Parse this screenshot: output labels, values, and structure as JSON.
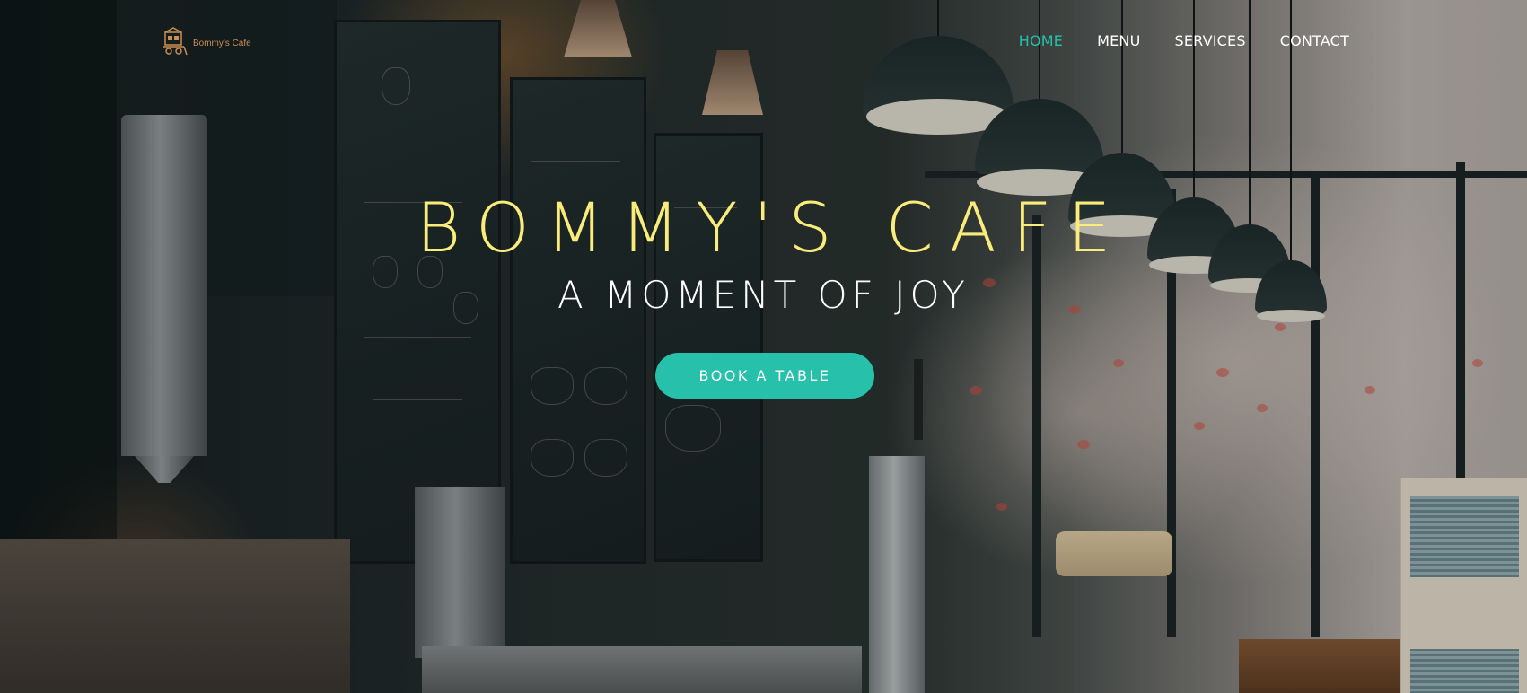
{
  "brand": {
    "logo_text": "Bommy's Cafe",
    "logo_icon": "coffee-cart-icon",
    "logo_color": "#c98f54"
  },
  "nav": {
    "items": [
      {
        "label": "HOME",
        "active": true
      },
      {
        "label": "MENU",
        "active": false
      },
      {
        "label": "SERVICES",
        "active": false
      },
      {
        "label": "CONTACT",
        "active": false
      }
    ],
    "active_color": "#26c0ab"
  },
  "hero": {
    "title": "BOMMY'S CAFE",
    "subtitle": "A MOMENT OF JOY",
    "cta_label": "BOOK A TABLE",
    "title_color": "#f9ec7a",
    "cta_color": "#26c0ab"
  }
}
